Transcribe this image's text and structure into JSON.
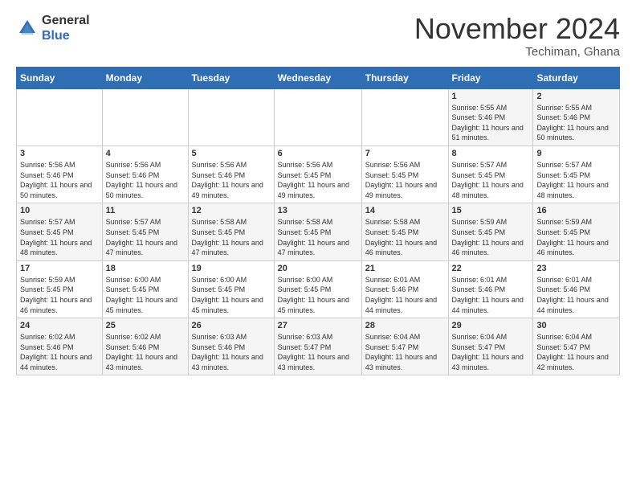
{
  "header": {
    "logo": {
      "general": "General",
      "blue": "Blue"
    },
    "month": "November 2024",
    "location": "Techiman, Ghana"
  },
  "weekdays": [
    "Sunday",
    "Monday",
    "Tuesday",
    "Wednesday",
    "Thursday",
    "Friday",
    "Saturday"
  ],
  "weeks": [
    [
      {
        "day": "",
        "info": ""
      },
      {
        "day": "",
        "info": ""
      },
      {
        "day": "",
        "info": ""
      },
      {
        "day": "",
        "info": ""
      },
      {
        "day": "",
        "info": ""
      },
      {
        "day": "1",
        "info": "Sunrise: 5:55 AM\nSunset: 5:46 PM\nDaylight: 11 hours and 51 minutes."
      },
      {
        "day": "2",
        "info": "Sunrise: 5:55 AM\nSunset: 5:46 PM\nDaylight: 11 hours and 50 minutes."
      }
    ],
    [
      {
        "day": "3",
        "info": "Sunrise: 5:56 AM\nSunset: 5:46 PM\nDaylight: 11 hours and 50 minutes."
      },
      {
        "day": "4",
        "info": "Sunrise: 5:56 AM\nSunset: 5:46 PM\nDaylight: 11 hours and 50 minutes."
      },
      {
        "day": "5",
        "info": "Sunrise: 5:56 AM\nSunset: 5:46 PM\nDaylight: 11 hours and 49 minutes."
      },
      {
        "day": "6",
        "info": "Sunrise: 5:56 AM\nSunset: 5:45 PM\nDaylight: 11 hours and 49 minutes."
      },
      {
        "day": "7",
        "info": "Sunrise: 5:56 AM\nSunset: 5:45 PM\nDaylight: 11 hours and 49 minutes."
      },
      {
        "day": "8",
        "info": "Sunrise: 5:57 AM\nSunset: 5:45 PM\nDaylight: 11 hours and 48 minutes."
      },
      {
        "day": "9",
        "info": "Sunrise: 5:57 AM\nSunset: 5:45 PM\nDaylight: 11 hours and 48 minutes."
      }
    ],
    [
      {
        "day": "10",
        "info": "Sunrise: 5:57 AM\nSunset: 5:45 PM\nDaylight: 11 hours and 48 minutes."
      },
      {
        "day": "11",
        "info": "Sunrise: 5:57 AM\nSunset: 5:45 PM\nDaylight: 11 hours and 47 minutes."
      },
      {
        "day": "12",
        "info": "Sunrise: 5:58 AM\nSunset: 5:45 PM\nDaylight: 11 hours and 47 minutes."
      },
      {
        "day": "13",
        "info": "Sunrise: 5:58 AM\nSunset: 5:45 PM\nDaylight: 11 hours and 47 minutes."
      },
      {
        "day": "14",
        "info": "Sunrise: 5:58 AM\nSunset: 5:45 PM\nDaylight: 11 hours and 46 minutes."
      },
      {
        "day": "15",
        "info": "Sunrise: 5:59 AM\nSunset: 5:45 PM\nDaylight: 11 hours and 46 minutes."
      },
      {
        "day": "16",
        "info": "Sunrise: 5:59 AM\nSunset: 5:45 PM\nDaylight: 11 hours and 46 minutes."
      }
    ],
    [
      {
        "day": "17",
        "info": "Sunrise: 5:59 AM\nSunset: 5:45 PM\nDaylight: 11 hours and 46 minutes."
      },
      {
        "day": "18",
        "info": "Sunrise: 6:00 AM\nSunset: 5:45 PM\nDaylight: 11 hours and 45 minutes."
      },
      {
        "day": "19",
        "info": "Sunrise: 6:00 AM\nSunset: 5:45 PM\nDaylight: 11 hours and 45 minutes."
      },
      {
        "day": "20",
        "info": "Sunrise: 6:00 AM\nSunset: 5:45 PM\nDaylight: 11 hours and 45 minutes."
      },
      {
        "day": "21",
        "info": "Sunrise: 6:01 AM\nSunset: 5:46 PM\nDaylight: 11 hours and 44 minutes."
      },
      {
        "day": "22",
        "info": "Sunrise: 6:01 AM\nSunset: 5:46 PM\nDaylight: 11 hours and 44 minutes."
      },
      {
        "day": "23",
        "info": "Sunrise: 6:01 AM\nSunset: 5:46 PM\nDaylight: 11 hours and 44 minutes."
      }
    ],
    [
      {
        "day": "24",
        "info": "Sunrise: 6:02 AM\nSunset: 5:46 PM\nDaylight: 11 hours and 44 minutes."
      },
      {
        "day": "25",
        "info": "Sunrise: 6:02 AM\nSunset: 5:46 PM\nDaylight: 11 hours and 43 minutes."
      },
      {
        "day": "26",
        "info": "Sunrise: 6:03 AM\nSunset: 5:46 PM\nDaylight: 11 hours and 43 minutes."
      },
      {
        "day": "27",
        "info": "Sunrise: 6:03 AM\nSunset: 5:47 PM\nDaylight: 11 hours and 43 minutes."
      },
      {
        "day": "28",
        "info": "Sunrise: 6:04 AM\nSunset: 5:47 PM\nDaylight: 11 hours and 43 minutes."
      },
      {
        "day": "29",
        "info": "Sunrise: 6:04 AM\nSunset: 5:47 PM\nDaylight: 11 hours and 43 minutes."
      },
      {
        "day": "30",
        "info": "Sunrise: 6:04 AM\nSunset: 5:47 PM\nDaylight: 11 hours and 42 minutes."
      }
    ]
  ]
}
